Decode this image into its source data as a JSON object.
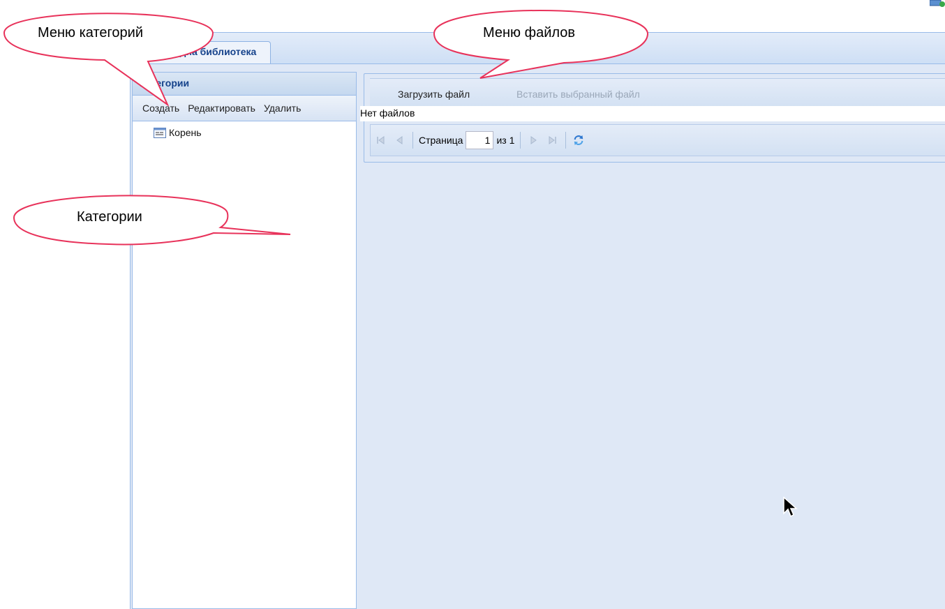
{
  "tab": {
    "label": "Медиа библиотека"
  },
  "categories_panel": {
    "title": "Категории",
    "toolbar": {
      "create": "Создать",
      "edit": "Редактировать",
      "delete": "Удалить"
    },
    "tree": [
      {
        "label": "Корень"
      }
    ]
  },
  "files_panel": {
    "toolbar": {
      "upload": "Загрузить файл",
      "insert": "Вставить выбранный файл"
    },
    "empty_text": "Нет файлов",
    "pager": {
      "page_label": "Страница",
      "page_value": "1",
      "of_label": "из 1"
    }
  },
  "annotations": {
    "categories_menu": "Меню категорий",
    "files_menu": "Меню файлов",
    "categories": "Категории",
    "color": "#e8325a"
  }
}
